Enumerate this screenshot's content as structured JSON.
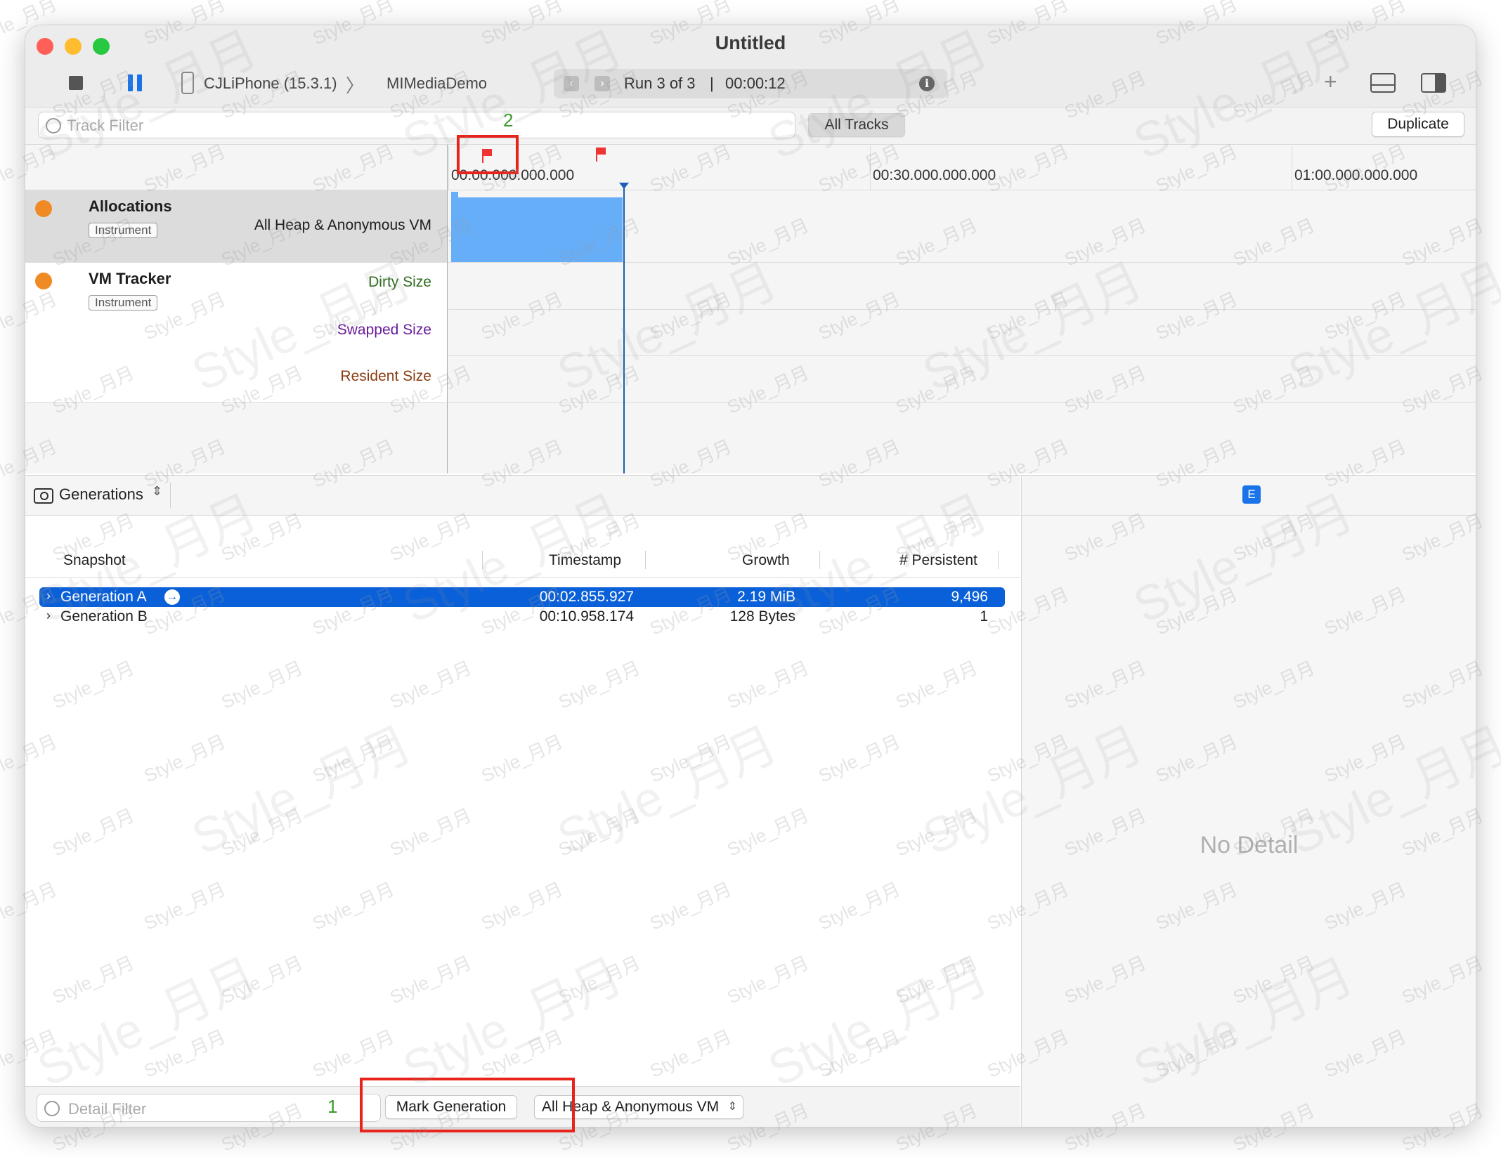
{
  "window": {
    "title": "Untitled",
    "traffic_lights": {
      "close": "#ff5f57",
      "minimize": "#febc2e",
      "zoom": "#28c840"
    }
  },
  "toolbar": {
    "device": "CJLiPhone (15.3.1)",
    "target": "MIMediaDemo",
    "run_status": "Run 3 of 3",
    "time_separator": "|",
    "elapsed": "00:00:12",
    "icons": [
      "stop-icon",
      "pause-icon",
      "phone-icon",
      "chevron-right-icon",
      "chevron-left-icon",
      "info-icon",
      "plus-icon",
      "bottom-panel-icon",
      "right-panel-icon"
    ]
  },
  "filter_bar": {
    "placeholder": "Track Filter",
    "all_tracks": "All Tracks",
    "duplicate": "Duplicate"
  },
  "annotations": {
    "flag_label": "2",
    "mark_label": "1",
    "highlight_color": "#e8231b"
  },
  "timeline": {
    "ticks": [
      "00:00.000.000.000",
      "00:30.000.000.000",
      "01:00.000.000.000"
    ],
    "playhead": "00:00:12",
    "accent": "#67aef8"
  },
  "tracks": [
    {
      "name": "Allocations",
      "badge": "Instrument",
      "series": [
        "All Heap & Anonymous VM"
      ]
    },
    {
      "name": "VM Tracker",
      "badge": "Instrument",
      "series": [
        "Dirty Size",
        "Swapped Size",
        "Resident Size"
      ]
    }
  ],
  "series_colors": {
    "dirty": "#2e6b1d",
    "swapped": "#6a1b9a",
    "resident": "#8a3b12"
  },
  "detail": {
    "view_selector": "Generations",
    "columns": [
      "Snapshot",
      "Timestamp",
      "Growth",
      "# Persistent"
    ],
    "rows": [
      {
        "snapshot": "Generation A",
        "timestamp": "00:02.855.927",
        "growth": "2.19 MiB",
        "persistent": "9,496",
        "selected": true
      },
      {
        "snapshot": "Generation B",
        "timestamp": "00:10.958.174",
        "growth": "128 Bytes",
        "persistent": "1",
        "selected": false
      }
    ],
    "selection_color": "#0a60d8"
  },
  "bottom_bar": {
    "placeholder": "Detail Filter",
    "mark_generation": "Mark Generation",
    "scope": "All Heap & Anonymous VM"
  },
  "inspector": {
    "badge": "E",
    "empty_text": "No Detail"
  },
  "watermark_text": "Style_月月"
}
